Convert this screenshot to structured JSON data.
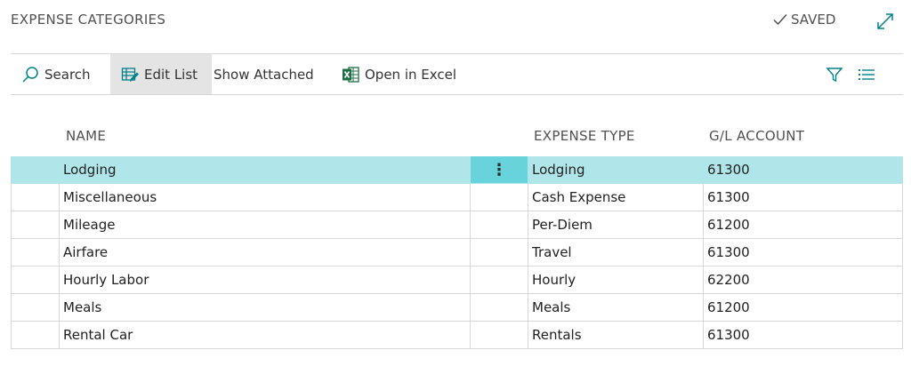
{
  "header": {
    "title": "EXPENSE CATEGORIES",
    "saved_label": "SAVED"
  },
  "toolbar": {
    "search": "Search",
    "edit_list": "Edit List",
    "show_attached": "Show Attached",
    "open_excel": "Open in Excel"
  },
  "columns": {
    "name": "NAME",
    "expense_type": "EXPENSE TYPE",
    "gl_account": "G/L ACCOUNT"
  },
  "rows": [
    {
      "name": "Lodging",
      "type": "Lodging",
      "account": "61300",
      "selected": true
    },
    {
      "name": "Miscellaneous",
      "type": "Cash Expense",
      "account": "61300"
    },
    {
      "name": "Mileage",
      "type": "Per-Diem",
      "account": "61200"
    },
    {
      "name": "Airfare",
      "type": "Travel",
      "account": "61300"
    },
    {
      "name": "Hourly Labor",
      "type": "Hourly",
      "account": "62200"
    },
    {
      "name": "Meals",
      "type": "Meals",
      "account": "61200"
    },
    {
      "name": "Rental Car",
      "type": "Rentals",
      "account": "61300"
    }
  ],
  "row_menu_glyph": "⋮",
  "colors": {
    "accent": "#008089",
    "selected_row": "#b0e6ea",
    "selected_menu": "#68d3db",
    "excel_green": "#1d7044"
  },
  "icons": [
    "check-icon",
    "expand-icon",
    "search-icon",
    "edit-list-icon",
    "excel-icon",
    "filter-icon",
    "list-view-icon"
  ]
}
